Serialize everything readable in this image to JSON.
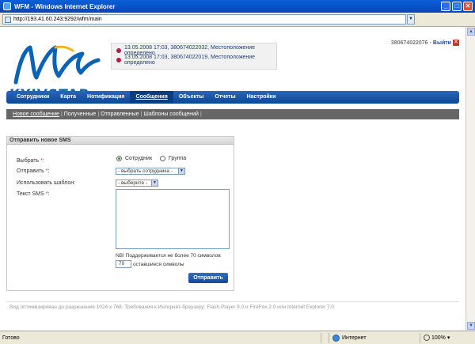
{
  "window": {
    "title": "WFM - Windows Internet Explorer"
  },
  "address": {
    "url": "http://193.41.60.243:9292/wfm/main"
  },
  "logo": {
    "text": "KYIVSTAR",
    "color": "#0a63b6"
  },
  "notifications": [
    {
      "text": "13.05.2008 17:03, 380674022032, Местоположение определено"
    },
    {
      "text": "13.05.2008 17:03, 380674022019, Местоположение определено"
    }
  ],
  "user": {
    "phone": "380674022076",
    "separator": "-",
    "logout_label": "Выйти",
    "logout_icon": "close-icon"
  },
  "nav": {
    "items": [
      {
        "label": "Сотрудники"
      },
      {
        "label": "Карта"
      },
      {
        "label": "Нотификация"
      },
      {
        "label": "Сообщения",
        "active": true
      },
      {
        "label": "Объекты"
      },
      {
        "label": "Отчеты"
      },
      {
        "label": "Настройки"
      }
    ]
  },
  "subnav": {
    "items": [
      {
        "label": "Новое сообщение",
        "active": true
      },
      {
        "label": "Полученные"
      },
      {
        "label": "Отправленные"
      },
      {
        "label": "Шаблоны сообщений"
      }
    ],
    "separator": "|"
  },
  "form": {
    "title": "Отправить новое SMS",
    "select_label": "Выбрать",
    "send_to_label": "Отправить",
    "template_label": "Использовать шаблон:",
    "text_label": "Текст SMS",
    "required_mark": "*",
    "colon": ":",
    "radio_employee": "Сотрудник",
    "radio_group": "Группа",
    "employee_select_value": "- выбрать сотрудника -",
    "template_select_value": "- выберите -",
    "hint": "NB! Поддерживается не более 70 символов",
    "counter_value": "70",
    "counter_label": "оставшиеся символы",
    "send_label": "Отправить"
  },
  "footer": {
    "text": "Вид оптимизирован до разрешения 1024 х 768. Требования к Интернет-браузеру: Flash Player 9.0 и FireFox 2.0 или Internet Explorer 7.0"
  },
  "status": {
    "left": "Готово",
    "zone": "Интернет",
    "zoom": "100%"
  }
}
